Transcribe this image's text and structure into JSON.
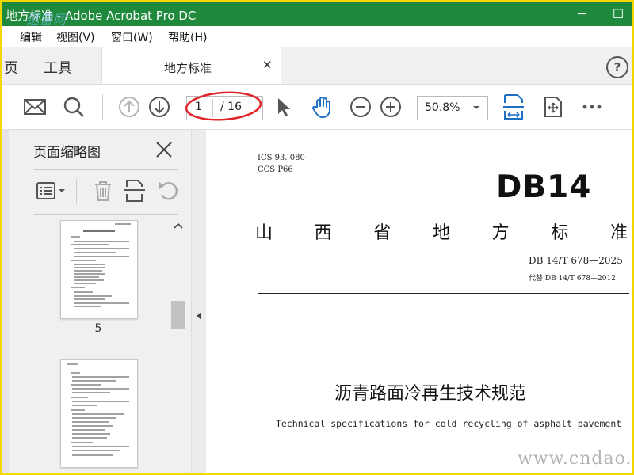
{
  "window": {
    "title": "地方标准 - Adobe Acrobat Pro DC",
    "watermark": "迅雷网",
    "accent_color": "#1f8a3c",
    "frame_color": "#f4d600"
  },
  "menu": {
    "items": [
      "编辑",
      "视图(V)",
      "窗口(W)",
      "帮助(H)"
    ]
  },
  "tabs": {
    "home": "页",
    "tools": "工具",
    "document": "地方标准"
  },
  "toolbar": {
    "page_current": "1",
    "page_total": "/ 16",
    "zoom": "50.8%",
    "icons": [
      "email-icon",
      "search-icon",
      "prev-page-icon",
      "next-page-icon",
      "select-cursor-icon",
      "hand-tool-icon",
      "zoom-out-icon",
      "zoom-in-icon",
      "fit-width-icon",
      "rotate-view-icon",
      "more-icon"
    ],
    "highlight_color": "#e0262a"
  },
  "thumbnails": {
    "title": "页面缩略图",
    "visible_page_label": "5"
  },
  "document": {
    "ics": "ICS   93. 080",
    "ccs": "CCS   P66",
    "code": "DB14",
    "standard_type_chars": [
      "山",
      "西",
      "省",
      "地",
      "方",
      "标",
      "准"
    ],
    "standard_number": "DB 14/T  678—2025",
    "replaces": "代替  DB 14/T  678—2012",
    "title_cn": "沥青路面冷再生技术规范",
    "title_en": "Technical  specifications  for  cold  recycling  of  asphalt  pavement"
  },
  "watermark_bottom": "www.cndao.com"
}
